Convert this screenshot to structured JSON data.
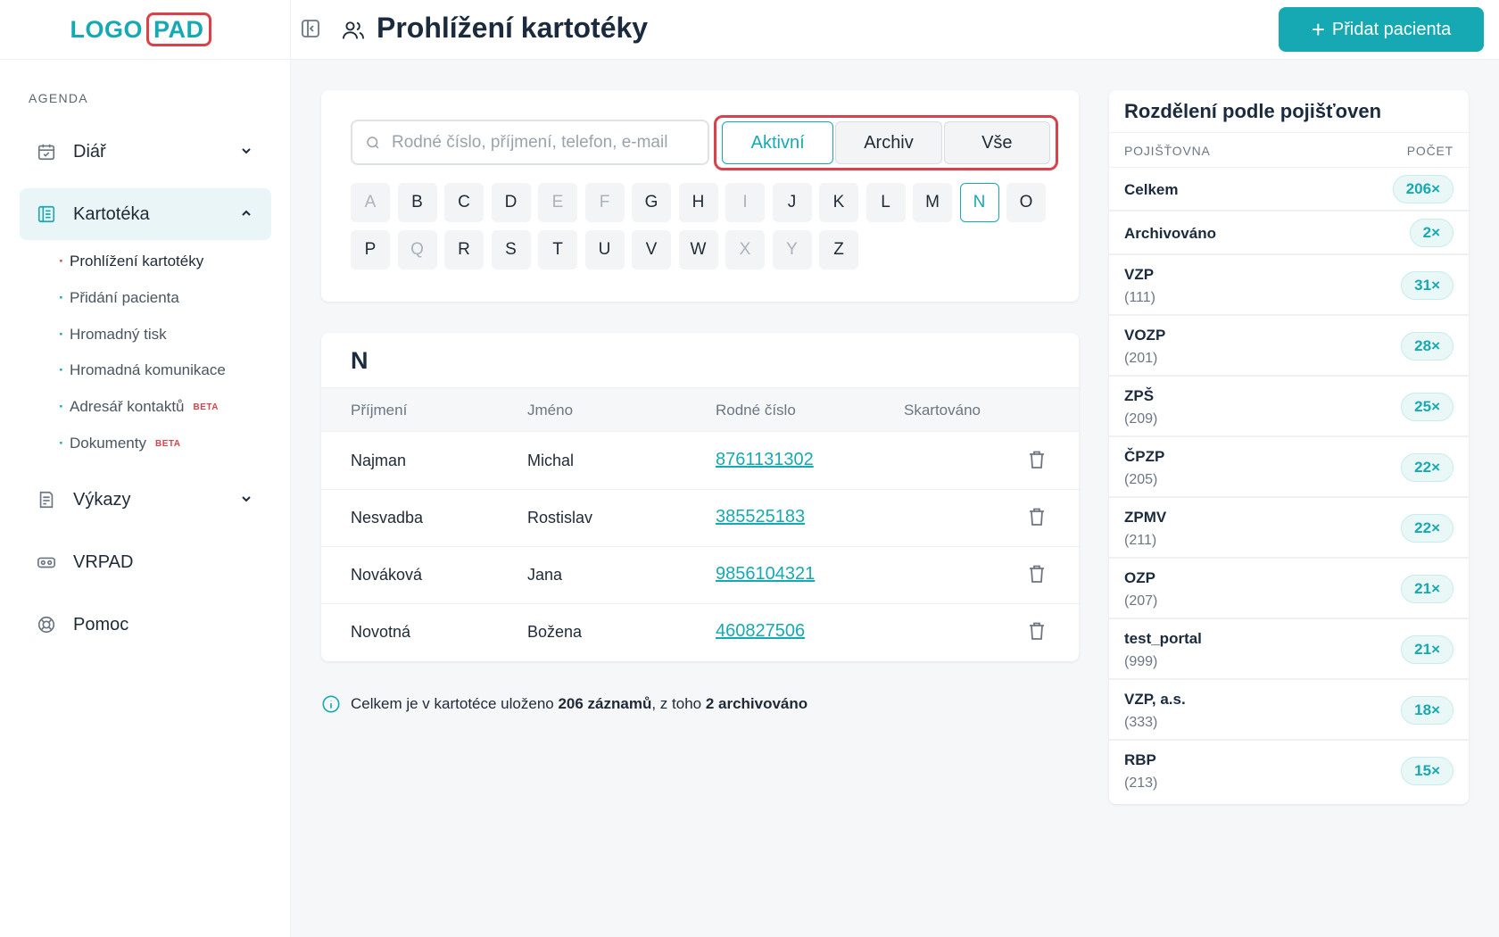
{
  "logo": {
    "part1": "LOGO",
    "part2": "PAD"
  },
  "sidebar": {
    "section_label": "AGENDA",
    "items": [
      {
        "label": "Diář",
        "icon": "calendar-icon"
      },
      {
        "label": "Kartotéka",
        "icon": "file-list-icon"
      },
      {
        "label": "Výkazy",
        "icon": "report-icon"
      },
      {
        "label": "VRPAD",
        "icon": "vr-headset-icon"
      },
      {
        "label": "Pomoc",
        "icon": "lifebuoy-icon"
      }
    ],
    "subitems": [
      {
        "label": "Prohlížení kartotéky"
      },
      {
        "label": "Přidání pacienta"
      },
      {
        "label": "Hromadný tisk"
      },
      {
        "label": "Hromadná komunikace"
      },
      {
        "label": "Adresář kontaktů",
        "badge": "BETA"
      },
      {
        "label": "Dokumenty",
        "badge": "BETA"
      }
    ]
  },
  "header": {
    "title": "Prohlížení kartotéky",
    "add_button": "Přidat pacienta"
  },
  "search": {
    "placeholder": "Rodné číslo, příjmení, telefon, e-mail",
    "filters": [
      "Aktivní",
      "Archiv",
      "Vše"
    ],
    "selected_filter": "Aktivní",
    "letters_row1": [
      {
        "l": "A",
        "state": "disabled"
      },
      {
        "l": "B",
        "state": "enabled"
      },
      {
        "l": "C",
        "state": "enabled"
      },
      {
        "l": "D",
        "state": "enabled"
      },
      {
        "l": "E",
        "state": "disabled"
      },
      {
        "l": "F",
        "state": "disabled"
      },
      {
        "l": "G",
        "state": "enabled"
      },
      {
        "l": "H",
        "state": "enabled"
      },
      {
        "l": "I",
        "state": "disabled"
      },
      {
        "l": "J",
        "state": "enabled"
      },
      {
        "l": "K",
        "state": "enabled"
      },
      {
        "l": "L",
        "state": "enabled"
      },
      {
        "l": "M",
        "state": "enabled"
      },
      {
        "l": "N",
        "state": "active"
      },
      {
        "l": "O",
        "state": "enabled"
      }
    ],
    "letters_row2": [
      {
        "l": "P",
        "state": "enabled"
      },
      {
        "l": "Q",
        "state": "disabled"
      },
      {
        "l": "R",
        "state": "enabled"
      },
      {
        "l": "S",
        "state": "enabled"
      },
      {
        "l": "T",
        "state": "enabled"
      },
      {
        "l": "U",
        "state": "enabled"
      },
      {
        "l": "V",
        "state": "enabled"
      },
      {
        "l": "W",
        "state": "enabled"
      },
      {
        "l": "X",
        "state": "disabled"
      },
      {
        "l": "Y",
        "state": "disabled"
      },
      {
        "l": "Z",
        "state": "enabled"
      }
    ]
  },
  "table": {
    "group": "N",
    "columns": [
      "Příjmení",
      "Jméno",
      "Rodné číslo",
      "Skartováno"
    ],
    "rows": [
      {
        "surname": "Najman",
        "name": "Michal",
        "rc": "8761131302"
      },
      {
        "surname": "Nesvadba",
        "name": "Rostislav",
        "rc": "385525183"
      },
      {
        "surname": "Nováková",
        "name": "Jana",
        "rc": "9856104321"
      },
      {
        "surname": "Novotná",
        "name": "Božena",
        "rc": "460827506"
      }
    ]
  },
  "info": {
    "prefix": "Celkem je v kartotéce uloženo ",
    "total": "206 záznamů",
    "middle": ", z toho ",
    "archived": "2 archivováno"
  },
  "insurance": {
    "title": "Rozdělení podle pojišťoven",
    "col_name": "POJIŠŤOVNA",
    "col_count": "POČET",
    "rows": [
      {
        "name": "Celkem",
        "code": "",
        "count": "206×"
      },
      {
        "name": "Archivováno",
        "code": "",
        "count": "2×"
      },
      {
        "name": "VZP",
        "code": "(111)",
        "count": "31×"
      },
      {
        "name": "VOZP",
        "code": "(201)",
        "count": "28×"
      },
      {
        "name": "ZPŠ",
        "code": "(209)",
        "count": "25×"
      },
      {
        "name": "ČPZP",
        "code": "(205)",
        "count": "22×"
      },
      {
        "name": "ZPMV",
        "code": "(211)",
        "count": "22×"
      },
      {
        "name": "OZP",
        "code": "(207)",
        "count": "21×"
      },
      {
        "name": "test_portal",
        "code": "(999)",
        "count": "21×"
      },
      {
        "name": "VZP, a.s.",
        "code": "(333)",
        "count": "18×"
      },
      {
        "name": "RBP",
        "code": "(213)",
        "count": "15×"
      }
    ]
  },
  "colors": {
    "accent": "#17a9b3",
    "highlight": "#d9424a"
  }
}
